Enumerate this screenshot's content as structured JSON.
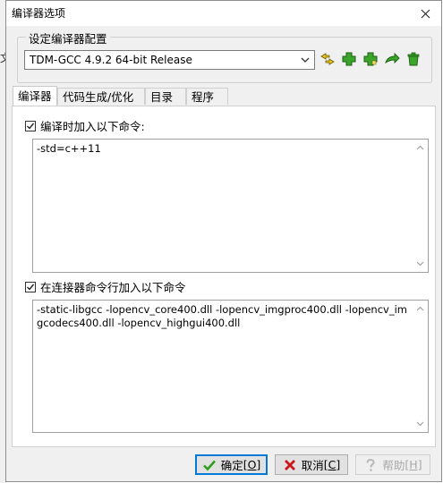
{
  "background_glyph": "文",
  "dialog": {
    "title": "编译器选项",
    "close_icon": "close-icon"
  },
  "compiler_config": {
    "group_label": "设定编译器配置",
    "selected": "TDM-GCC 4.9.2 64-bit Release",
    "toolbar_icons": [
      "sort-icon",
      "add-icon",
      "add-copy-icon",
      "rename-icon",
      "delete-icon"
    ]
  },
  "tabs": [
    {
      "label": "编译器",
      "active": true
    },
    {
      "label": "代码生成/优化",
      "active": false
    },
    {
      "label": "目录",
      "active": false
    },
    {
      "label": "程序",
      "active": false
    }
  ],
  "compiler_options": {
    "compile_check_label": "编译时加入以下命令:",
    "compile_checked": true,
    "compile_commands": "-std=c++11",
    "linker_check_label": "在连接器命令行加入以下命令",
    "linker_checked": true,
    "linker_commands": "-static-libgcc -lopencv_core400.dll -lopencv_imgproc400.dll -lopencv_imgcodecs400.dll -lopencv_highgui400.dll"
  },
  "buttons": {
    "ok": {
      "label": "确定",
      "accel": "[O]"
    },
    "cancel": {
      "label": "取消",
      "accel": "[C]"
    },
    "help": {
      "label": "帮助",
      "accel": "[H]",
      "enabled": false
    }
  },
  "colors": {
    "accent": "#0078d7",
    "green_icon": "#2f9e1f",
    "red_x": "#c8181e"
  }
}
